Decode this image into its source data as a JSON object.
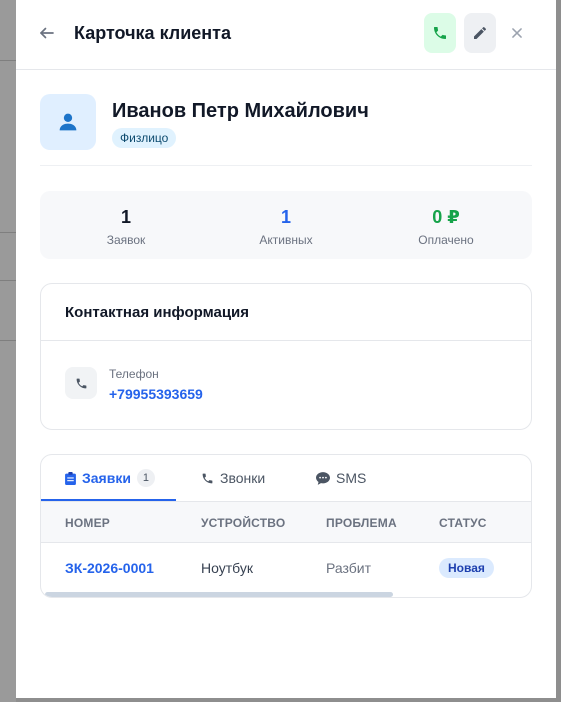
{
  "header": {
    "title": "Карточка клиента",
    "back_icon": "arrow-left-icon",
    "call_icon": "phone-icon",
    "edit_icon": "pencil-icon",
    "close_icon": "close-icon"
  },
  "client": {
    "name": "Иванов Петр Михайлович",
    "type": "Физлицо",
    "avatar_icon": "user-icon"
  },
  "stats": [
    {
      "value": "1",
      "label": "Заявок",
      "color": "#111827"
    },
    {
      "value": "1",
      "label": "Активных",
      "color": "#2563eb"
    },
    {
      "value": "0 ₽",
      "label": "Оплачено",
      "color": "#16a34a"
    }
  ],
  "contact": {
    "title": "Контактная информация",
    "phone_label": "Телефон",
    "phone_value": "+79955393659"
  },
  "tabs": [
    {
      "label": "Заявки",
      "count": "1",
      "icon": "clipboard-icon",
      "active": true
    },
    {
      "label": "Звонки",
      "icon": "phone-icon",
      "active": false
    },
    {
      "label": "SMS",
      "icon": "chat-icon",
      "active": false
    }
  ],
  "table": {
    "columns": [
      "НОМЕР",
      "УСТРОЙСТВО",
      "ПРОБЛЕМА",
      "СТАТУС"
    ],
    "rows": [
      {
        "number": "ЗК-2026-0001",
        "device": "Ноутбук",
        "problem": "Разбит",
        "status": "Новая"
      }
    ]
  },
  "colors": {
    "accent": "#2563eb",
    "success": "#16a34a",
    "call_bg": "#dcfce7"
  }
}
